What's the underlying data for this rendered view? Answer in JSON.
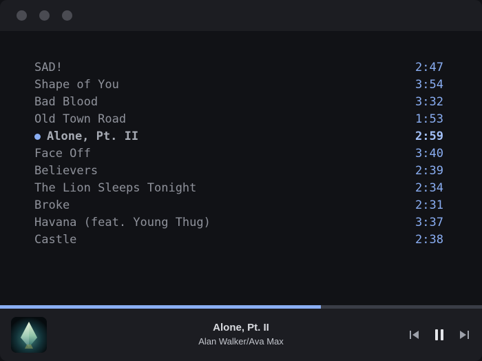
{
  "tracks": [
    {
      "title": "SAD!",
      "duration": "2:47"
    },
    {
      "title": "Shape of You",
      "duration": "3:54"
    },
    {
      "title": "Bad Blood",
      "duration": "3:32"
    },
    {
      "title": "Old Town Road",
      "duration": "1:53"
    },
    {
      "title": "Alone, Pt. II",
      "duration": "2:59",
      "active": true
    },
    {
      "title": "Face Off",
      "duration": "3:40"
    },
    {
      "title": "Believers",
      "duration": "2:39"
    },
    {
      "title": "The Lion Sleeps Tonight",
      "duration": "2:34"
    },
    {
      "title": "Broke",
      "duration": "2:31"
    },
    {
      "title": "Havana (feat. Young Thug)",
      "duration": "3:37"
    },
    {
      "title": "Castle",
      "duration": "2:38"
    }
  ],
  "now_playing": {
    "title": "Alone, Pt. II",
    "artist": "Alan Walker/Ava Max",
    "progress_fraction": 0.665
  },
  "controls": {
    "previous_icon": "skip-previous-icon",
    "pause_icon": "pause-icon",
    "next_icon": "skip-next-icon"
  },
  "colors": {
    "accent": "#8aaef3",
    "track_text": "#8f929b",
    "background": "#111216",
    "panel": "#1c1d22"
  }
}
